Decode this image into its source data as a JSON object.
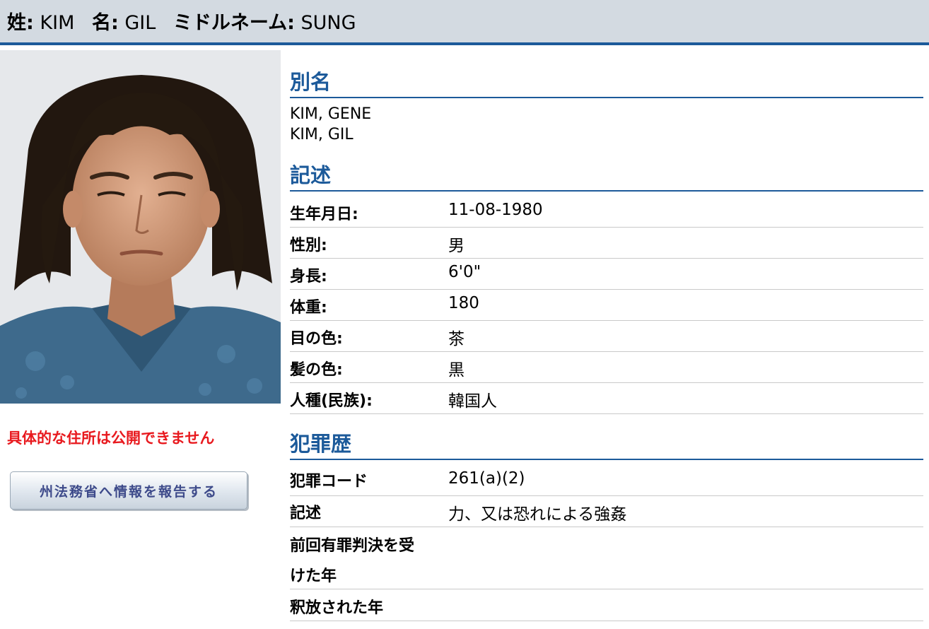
{
  "header": {
    "last_name_label": "姓:",
    "last_name": "KIM",
    "first_name_label": "名:",
    "first_name": "GIL",
    "middle_name_label": "ミドルネーム:",
    "middle_name": "SUNG"
  },
  "photo": {
    "alt": "Photo of KIM GIL SUNG"
  },
  "address_note": "具体的な住所は公開できません",
  "report_button": "州法務省へ情報を報告する",
  "aliases": {
    "title": "別名",
    "items": [
      "KIM, GENE",
      "KIM, GIL"
    ]
  },
  "description": {
    "title": "記述",
    "rows": [
      {
        "label": "生年月日:",
        "value": "11-08-1980"
      },
      {
        "label": "性別:",
        "value": "男"
      },
      {
        "label": "身長:",
        "value": "6'0\""
      },
      {
        "label": "体重:",
        "value": "180"
      },
      {
        "label": "目の色:",
        "value": "茶"
      },
      {
        "label": "髪の色:",
        "value": "黒"
      },
      {
        "label": "人種(民族):",
        "value": "韓国人"
      }
    ]
  },
  "crimes": {
    "title": "犯罪歴",
    "code_label": "犯罪コード",
    "code_value": "261(a)(2)",
    "desc_label": "記述",
    "desc_value": "力、又は恐れによる強姦",
    "conviction_label_1": "前回有罪判決を受",
    "conviction_label_2": "けた年",
    "release_label": "釈放された年"
  },
  "colors": {
    "accent": "#1c5a9a",
    "header_bg": "#d3dae1",
    "warning": "#e8191e"
  }
}
